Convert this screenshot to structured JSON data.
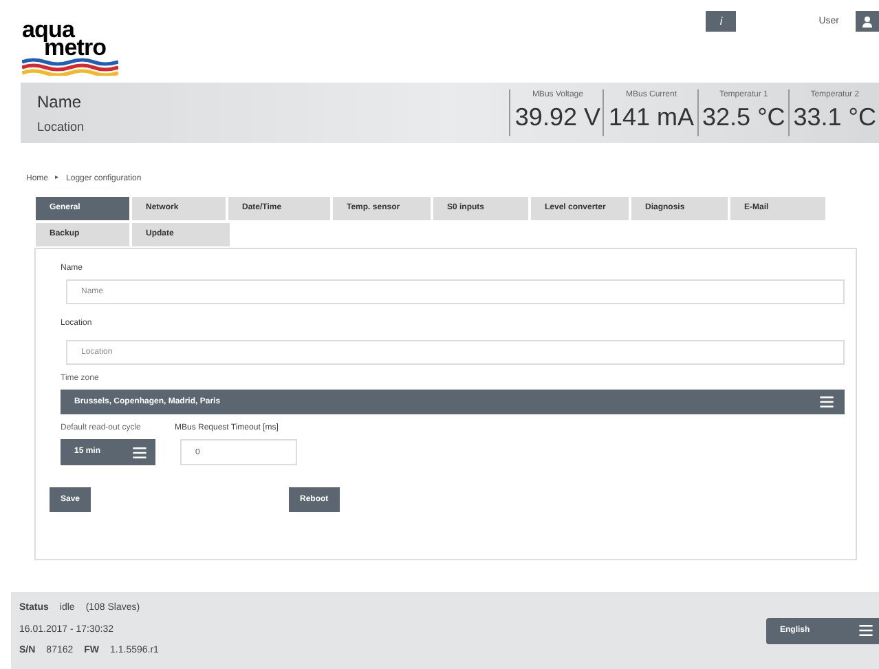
{
  "logo": {
    "line_1": "aqua",
    "line_2": "metro"
  },
  "topbar": {
    "info_button": "i",
    "user_label": "User"
  },
  "header": {
    "name": "Name",
    "location": "Location",
    "readings": [
      {
        "label": "MBus Voltage",
        "value": "39.92 V"
      },
      {
        "label": "MBus Current",
        "value": "141 mA"
      },
      {
        "label": "Temperatur 1",
        "value": "32.5 °C"
      },
      {
        "label": "Temperatur 2",
        "value": "33.1 °C"
      }
    ]
  },
  "breadcrumb": {
    "items": [
      "Home",
      "Logger configuration"
    ],
    "separator": "▸"
  },
  "tabs": [
    {
      "label": "General",
      "selected": true
    },
    {
      "label": "Network",
      "selected": false
    },
    {
      "label": "Date/Time",
      "selected": false
    },
    {
      "label": "Temp. sensor",
      "selected": false
    },
    {
      "label": "S0 inputs",
      "selected": false
    },
    {
      "label": "Level converter",
      "selected": false
    },
    {
      "label": "Diagnosis",
      "selected": false
    },
    {
      "label": "E-Mail",
      "selected": false
    },
    {
      "label": "Backup",
      "selected": false
    },
    {
      "label": "Update",
      "selected": false
    }
  ],
  "form": {
    "name": {
      "label": "Name",
      "placeholder": "Name"
    },
    "location": {
      "label": "Location",
      "placeholder": "Location"
    },
    "time_zone": {
      "label": "Time zone",
      "value": "Brussels, Copenhagen, Madrid, Paris"
    },
    "readout_cycle": {
      "label": "Default read-out cycle",
      "value": "15 min"
    },
    "mbus_timeout": {
      "label": "MBus Request Timeout [ms]",
      "value": "0"
    },
    "buttons": [
      "Save",
      "Reboot"
    ]
  },
  "footer": {
    "status_label": "Status",
    "status": "idle",
    "slaves": "(108 Slaves)",
    "datetime": "16.01.2017 - 17:30:32",
    "sn_label": "S/N",
    "sn": "87162",
    "fw_label": "FW",
    "fw": "1.1.5596.r1",
    "language": "English"
  }
}
